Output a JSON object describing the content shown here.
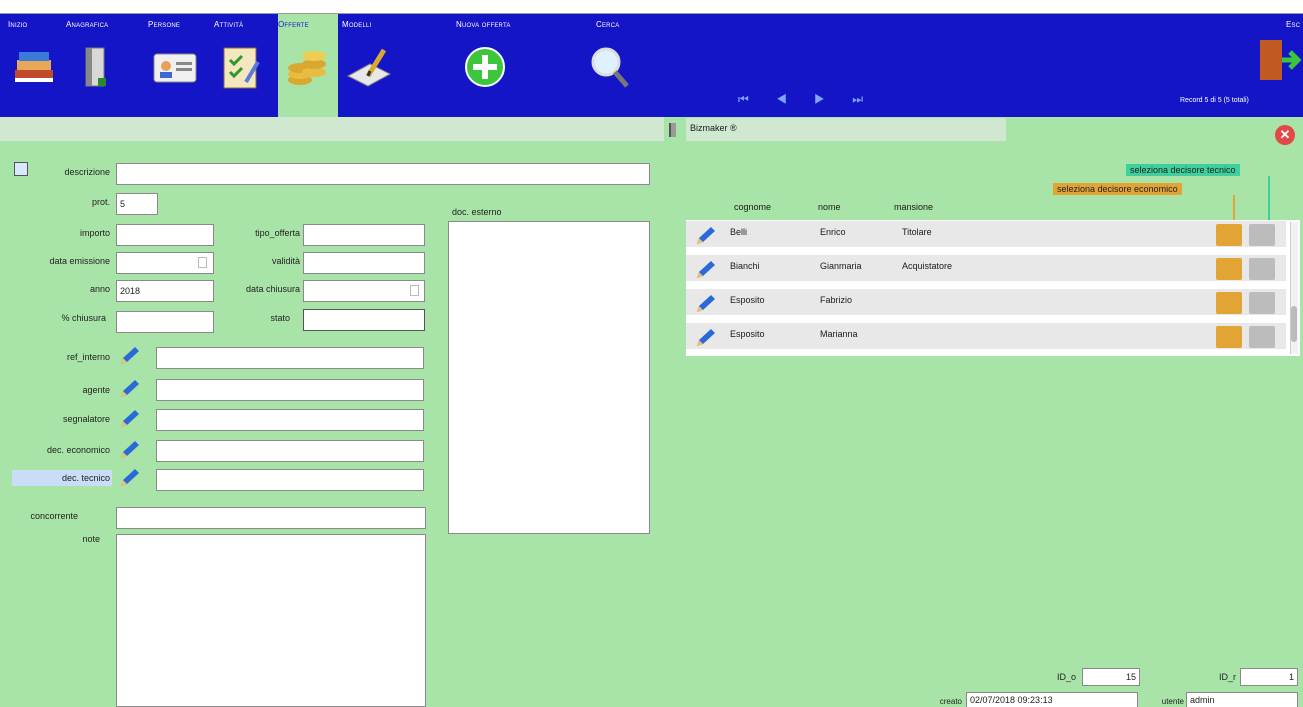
{
  "toolbar": {
    "items": [
      {
        "label": "Inizio",
        "icon": "books-icon"
      },
      {
        "label": "Anagrafica",
        "icon": "binder-icon"
      },
      {
        "label": "Persone",
        "icon": "id-card-icon"
      },
      {
        "label": "Attività",
        "icon": "checklist-icon"
      },
      {
        "label": "Offerte",
        "icon": "coins-icon"
      },
      {
        "label": "Modelli",
        "icon": "document-pen-icon"
      },
      {
        "label": "Nuova offerta",
        "icon": "plus-icon"
      },
      {
        "label": "Cerca",
        "icon": "magnifier-icon"
      },
      {
        "label": "Esc",
        "icon": "exit-door-icon"
      }
    ],
    "nav": "⏮ ◀ ▶ ⏭",
    "record_count": "Record 5 di 5 (5 totali)"
  },
  "header": {
    "company": "Bizmaker ®",
    "close": "✕"
  },
  "form": {
    "descrizione": {
      "label": "descrizione",
      "value": ""
    },
    "prot": {
      "label": "prot.",
      "value": "5"
    },
    "importo": {
      "label": "importo",
      "value": ""
    },
    "tipo_offerta": {
      "label": "tipo_offerta",
      "value": ""
    },
    "data_emissione": {
      "label": "data emissione",
      "value": ""
    },
    "validita": {
      "label": "validità",
      "value": ""
    },
    "anno": {
      "label": "anno",
      "value": "2018"
    },
    "data_chiusura": {
      "label": "data chiusura",
      "value": ""
    },
    "perc_chiusura": {
      "label": "% chiusura",
      "value": ""
    },
    "stato": {
      "label": "stato",
      "value": ""
    },
    "ref_interno": {
      "label": "ref_interno",
      "value": ""
    },
    "agente": {
      "label": "agente",
      "value": ""
    },
    "segnalatore": {
      "label": "segnalatore",
      "value": ""
    },
    "dec_economico": {
      "label": "dec. economico",
      "value": ""
    },
    "dec_tecnico": {
      "label": "dec. tecnico",
      "value": ""
    },
    "concorrente": {
      "label": "concorrente",
      "value": ""
    },
    "note": {
      "label": "note",
      "value": ""
    },
    "doc_esterno": {
      "label": "doc. esterno"
    }
  },
  "contacts": {
    "tag_tecnico": "seleziona decisore tecnico",
    "tag_economico": "seleziona decisore economico",
    "columns": [
      "cognome",
      "nome",
      "mansione"
    ],
    "rows": [
      {
        "cognome": "Belli",
        "nome": "Enrico",
        "mansione": "Titolare"
      },
      {
        "cognome": "Bianchi",
        "nome": "Gianmaria",
        "mansione": "Acquistatore"
      },
      {
        "cognome": "Esposito",
        "nome": "Fabrizio",
        "mansione": ""
      },
      {
        "cognome": "Esposito",
        "nome": "Marianna",
        "mansione": ""
      }
    ]
  },
  "footer": {
    "id_o_label": "ID_o",
    "id_o": "15",
    "id_r_label": "ID_r",
    "id_r": "1",
    "creato_label": "creato",
    "creato": "02/07/2018 09:23:13",
    "utente_label": "utente",
    "utente": "admin"
  },
  "colors": {
    "toolbar": "#1515c8",
    "background": "#a8e4a8",
    "economico": "#e2a535",
    "tecnico": "#3fcf9c"
  }
}
